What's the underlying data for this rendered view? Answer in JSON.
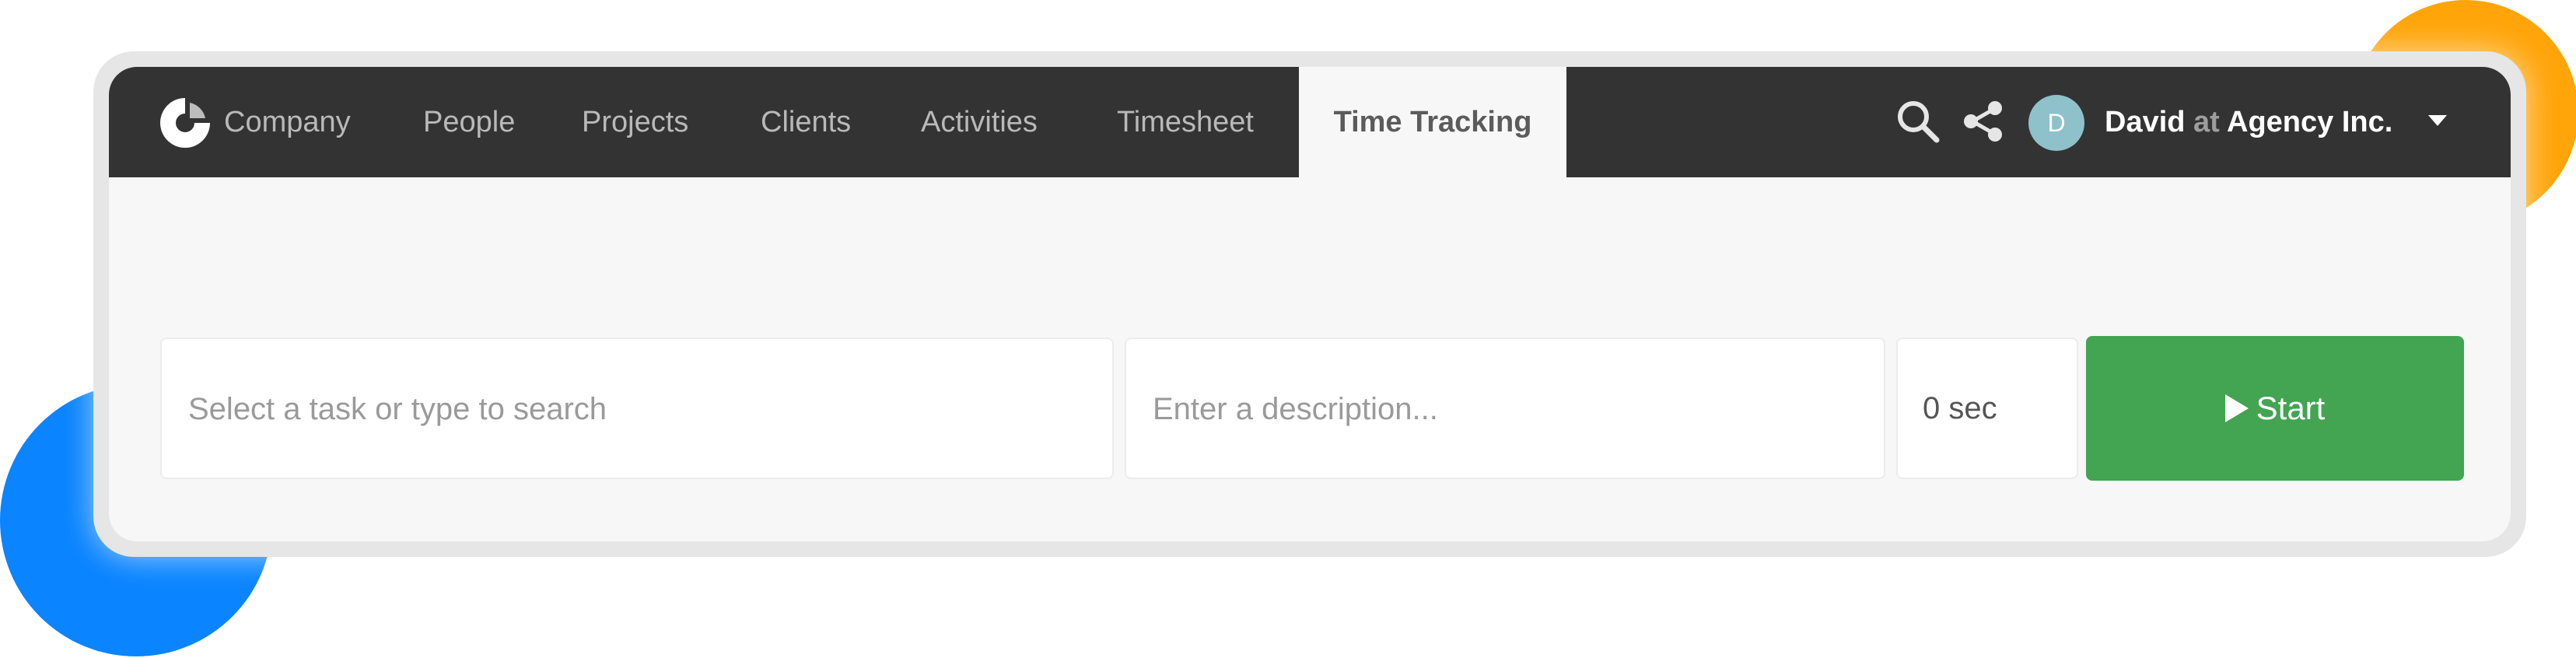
{
  "nav": {
    "items": [
      {
        "label": "Company"
      },
      {
        "label": "People"
      },
      {
        "label": "Projects"
      },
      {
        "label": "Clients"
      },
      {
        "label": "Activities"
      },
      {
        "label": "Timesheet"
      },
      {
        "label": "Time Tracking",
        "active": true
      }
    ]
  },
  "icons": {
    "logo": "app-logo-icon",
    "search": "search-icon",
    "share": "share-icon",
    "dropdown": "chevron-down-icon"
  },
  "user": {
    "avatar_initial": "D",
    "name": "David",
    "at": "at",
    "company": "Agency Inc."
  },
  "tracker": {
    "task_placeholder": "Select a task or type to search",
    "description_placeholder": "Enter a description...",
    "timer_value": "0 sec",
    "start_label": "Start"
  },
  "colors": {
    "navbar": "#333333",
    "start_button": "#43a452",
    "avatar": "#8fc1cb",
    "accent_blue": "#0a84ff",
    "accent_orange": "#ffa50a"
  }
}
